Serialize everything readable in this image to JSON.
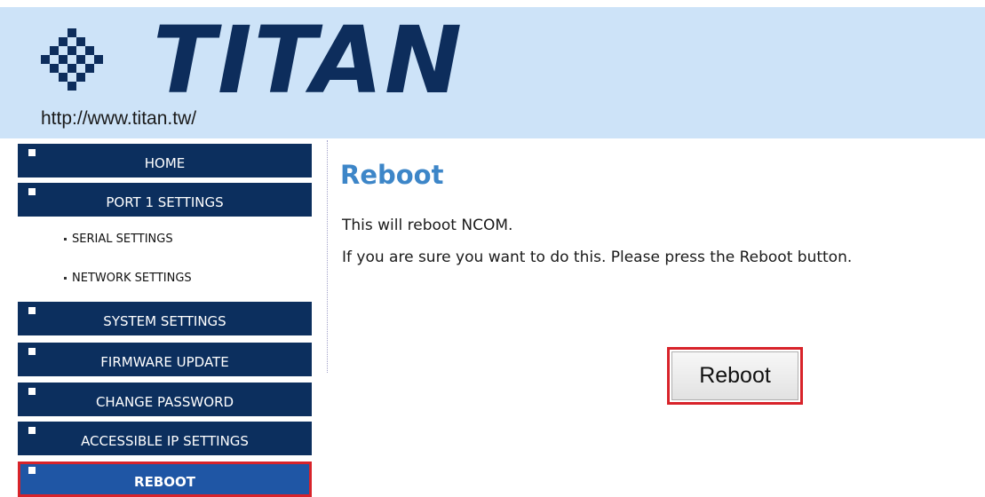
{
  "header": {
    "logo_text": "TITAN",
    "logo_url": "http://www.titan.tw/",
    "logo_icon": "titan-checker-logo-icon"
  },
  "sidebar": {
    "items": [
      {
        "label": "HOME"
      },
      {
        "label": "PORT 1 SETTINGS"
      },
      {
        "label": "SYSTEM SETTINGS"
      },
      {
        "label": "FIRMWARE UPDATE"
      },
      {
        "label": "CHANGE PASSWORD"
      },
      {
        "label": "ACCESSIBLE IP SETTINGS"
      },
      {
        "label": "REBOOT",
        "active": true
      }
    ],
    "sub_items": [
      {
        "label": "SERIAL SETTINGS"
      },
      {
        "label": "NETWORK SETTINGS"
      }
    ]
  },
  "main": {
    "title": "Reboot",
    "line1": "This will reboot NCOM.",
    "line2": "If you are sure you want to do this. Please press the Reboot button.",
    "reboot_button": "Reboot"
  },
  "colors": {
    "nav_bg": "#0c2f5e",
    "nav_active_bg": "#1f56a5",
    "highlight_border": "#d8232a",
    "header_bg": "#cde3f8",
    "title_color": "#3d86c8"
  }
}
